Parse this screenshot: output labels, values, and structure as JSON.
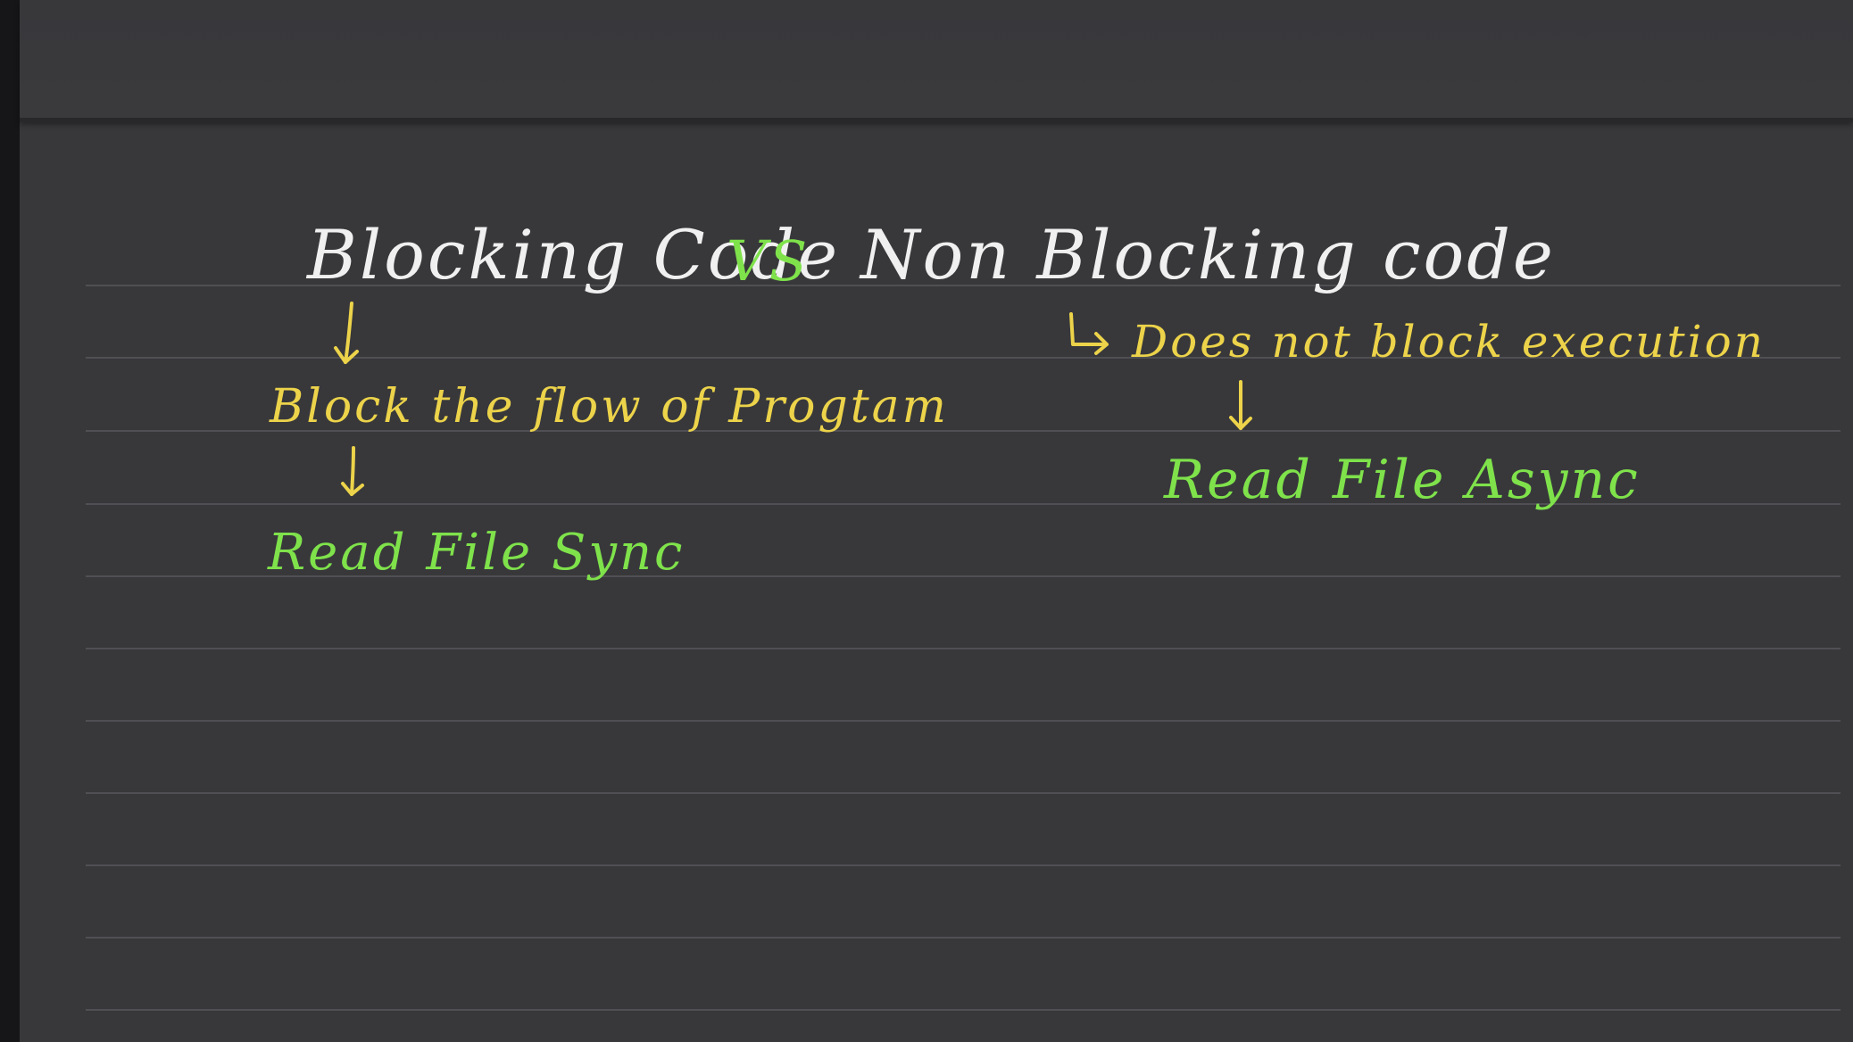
{
  "board": {
    "title": {
      "left": "Blocking Code",
      "separator": "VS",
      "right": "Non Blocking code"
    },
    "blocking": {
      "description": "Block the flow of Progtam",
      "example": "Read File Sync"
    },
    "non_blocking": {
      "description": "Does not block execution",
      "example": "Read File Async"
    }
  },
  "colors": {
    "background": "#38383b",
    "title": "#f0f0f0",
    "description": "#ecd34a",
    "example": "#7fe24b"
  },
  "icons": {
    "down_arrow": "down-arrow-icon",
    "bent_arrow": "bent-arrow-icon"
  }
}
